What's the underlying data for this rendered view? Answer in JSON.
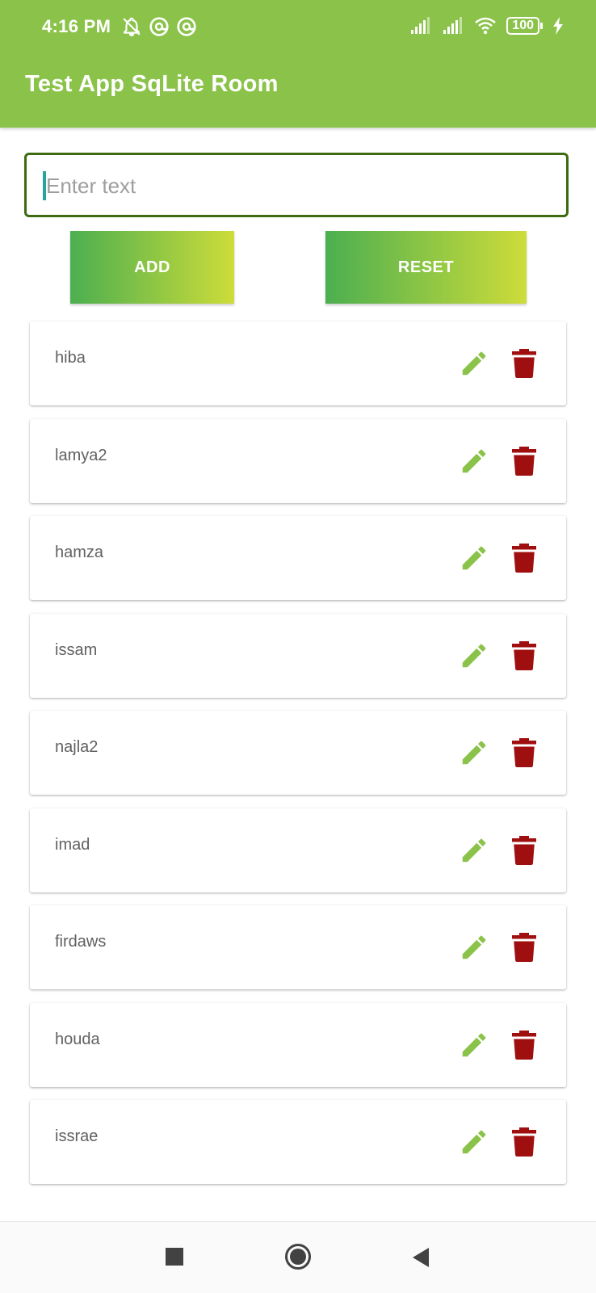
{
  "status_bar": {
    "time": "4:16 PM",
    "battery": "100"
  },
  "app_bar": {
    "title": "Test App SqLite Room"
  },
  "input": {
    "placeholder": "Enter text",
    "value": ""
  },
  "buttons": {
    "add": "ADD",
    "reset": "RESET"
  },
  "items": [
    {
      "name": "hiba"
    },
    {
      "name": "lamya2"
    },
    {
      "name": "hamza"
    },
    {
      "name": "issam"
    },
    {
      "name": "najla2"
    },
    {
      "name": "imad"
    },
    {
      "name": "firdaws"
    },
    {
      "name": "houda"
    },
    {
      "name": "issrae"
    }
  ],
  "colors": {
    "app_bar": "#8bc34a",
    "input_border": "#3d6b12",
    "edit_icon": "#8bc34a",
    "delete_icon": "#a00f0f",
    "button_gradient_start": "#4caf50",
    "button_gradient_end": "#cddc39"
  },
  "icons": {
    "status_left": [
      "notifications-off-icon",
      "at-sign-icon",
      "at-sign-icon"
    ],
    "status_right": [
      "signal-icon",
      "signal-icon",
      "wifi-icon",
      "battery-icon",
      "charging-icon"
    ],
    "row_actions": [
      "edit-pencil-icon",
      "delete-trash-icon"
    ],
    "nav": [
      "recent-apps-icon",
      "home-icon",
      "back-icon"
    ]
  }
}
